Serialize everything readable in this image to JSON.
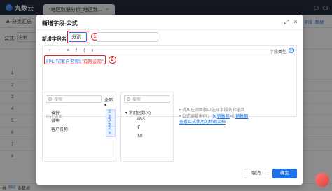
{
  "app": {
    "logo_text": "九数云",
    "tab_label": "*地区数据分析_地区数...",
    "toolbar": {
      "left_label": "分类汇总",
      "right_items": [
        "字段",
        "数据"
      ]
    },
    "formula_bar": {
      "label": "公式",
      "select_value": "分割"
    },
    "row_numbers": [
      "1",
      "2",
      "3",
      "4",
      "5",
      "6",
      "7",
      "8"
    ],
    "footer": {
      "prefix": "共",
      "count": "592",
      "suffix": "条数据"
    }
  },
  "modal": {
    "title": "新增字段-公式",
    "field_name_label": "新增字段名",
    "field_name_value": "分割",
    "badge1": "1",
    "badge2": "2",
    "operators": [
      "+",
      "−",
      "×",
      "/",
      "(",
      ")"
    ],
    "field_type_label": "字段类型",
    "field_type_icon": "clock-icon",
    "formula_fn": "SPLIT(",
    "formula_field": "[客户名称]",
    "formula_sep": ",",
    "formula_str": "\"有限公司\"",
    "formula_end": ")",
    "syntax_label": "公式语法",
    "fields_panel": {
      "search_placeholder": "搜索",
      "dropdown_value": "全部",
      "items": [
        {
          "name": "省份",
          "type": "文本"
        },
        {
          "name": "城市",
          "type": "文本"
        },
        {
          "name": "客户名称",
          "type": "文本"
        }
      ]
    },
    "functions_panel": {
      "search_placeholder": "搜索",
      "group": "常用函数(4)",
      "items": [
        "ABS",
        "IF",
        "INT"
      ]
    },
    "hints": {
      "line1": "• 请从左侧面板中选择字段名和函数",
      "line2_prefix": "• 公式编辑举例：",
      "line2_fx": "|fx|",
      "line2_a": "销售额",
      "line2_mid": "=0,",
      "line2_b": "销售额",
      "line2_end": ")",
      "link": "查看公式使用的帮助文档"
    },
    "cancel_label": "取消",
    "ok_label": "确定"
  }
}
